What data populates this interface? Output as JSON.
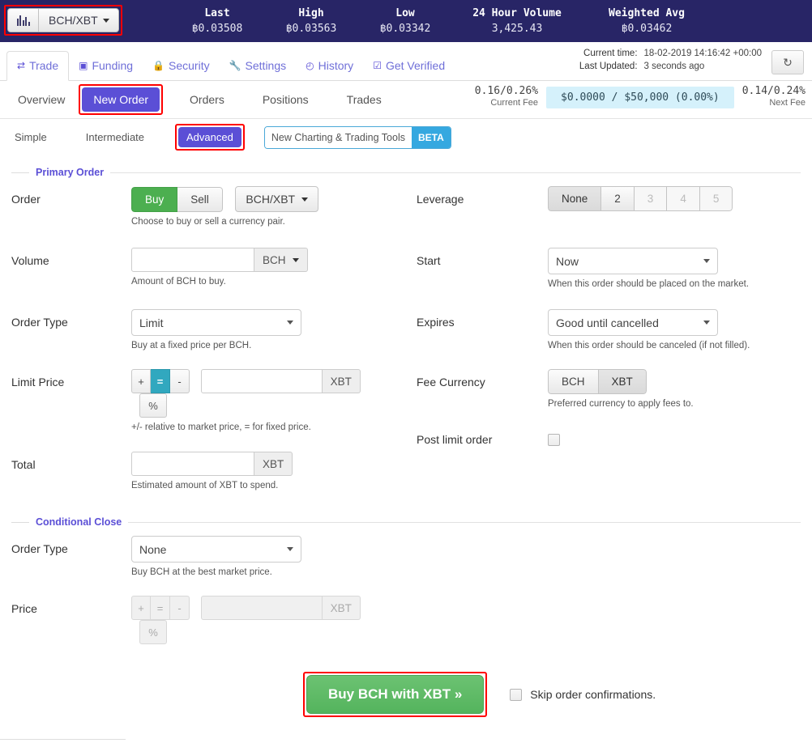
{
  "ticker": {
    "pair_button": {
      "label": "BCH/XBT",
      "icon": "chart-bars-icon",
      "caret": "▼"
    },
    "stats": [
      {
        "title": "Last",
        "value": "฿0.03508"
      },
      {
        "title": "High",
        "value": "฿0.03563"
      },
      {
        "title": "Low",
        "value": "฿0.03342"
      },
      {
        "title": "24 Hour Volume",
        "value": "3,425.43"
      },
      {
        "title": "Weighted Avg",
        "value": "฿0.03462"
      }
    ]
  },
  "mainnav": {
    "tabs": [
      {
        "label": "Trade",
        "icon": "exchange-icon",
        "glyph": "⇄",
        "active": true
      },
      {
        "label": "Funding",
        "icon": "banknote-icon",
        "glyph": "▣",
        "active": false
      },
      {
        "label": "Security",
        "icon": "lock-icon",
        "glyph": "🔒",
        "active": false
      },
      {
        "label": "Settings",
        "icon": "wrench-icon",
        "glyph": "🔧",
        "active": false
      },
      {
        "label": "History",
        "icon": "clock-icon",
        "glyph": "◴",
        "active": false
      },
      {
        "label": "Get Verified",
        "icon": "check-square-icon",
        "glyph": "☑",
        "active": false
      }
    ],
    "current_time_label": "Current time:",
    "current_time_value": "18-02-2019 14:16:42 +00:00",
    "last_updated_label": "Last Updated:",
    "last_updated_value": "3 seconds ago",
    "refresh_icon": "refresh-icon",
    "refresh_glyph": "↻"
  },
  "subnav": {
    "tabs": [
      {
        "label": "Overview",
        "active": false
      },
      {
        "label": "New Order",
        "active": true
      },
      {
        "label": "Orders",
        "active": false
      },
      {
        "label": "Positions",
        "active": false
      },
      {
        "label": "Trades",
        "active": false
      }
    ],
    "current_fee_value": "0.16/0.26%",
    "current_fee_label": "Current Fee",
    "volume_pill": "$0.0000 / $50,000 (0.00%)",
    "next_fee_value": "0.14/0.24%",
    "next_fee_label": "Next Fee"
  },
  "modes": {
    "items": [
      {
        "label": "Simple",
        "active": false
      },
      {
        "label": "Intermediate",
        "active": false
      },
      {
        "label": "Advanced",
        "active": true
      }
    ],
    "beta_text": "New Charting & Trading Tools",
    "beta_badge": "BETA"
  },
  "primary_order": {
    "legend": "Primary Order",
    "order": {
      "label": "Order",
      "buy": "Buy",
      "sell": "Sell",
      "pair": "BCH/XBT",
      "hint": "Choose to buy or sell a currency pair."
    },
    "volume": {
      "label": "Volume",
      "value": "",
      "unit": "BCH",
      "hint": "Amount of BCH to buy."
    },
    "order_type": {
      "label": "Order Type",
      "value": "Limit",
      "hint": "Buy at a fixed price per BCH."
    },
    "limit_price": {
      "label": "Limit Price",
      "plus": "+",
      "equals": "=",
      "minus": "-",
      "value": "",
      "unit": "XBT",
      "percent": "%",
      "hint": "+/- relative to market price, = for fixed price."
    },
    "total": {
      "label": "Total",
      "value": "",
      "unit": "XBT",
      "hint": "Estimated amount of XBT to spend."
    },
    "leverage": {
      "label": "Leverage",
      "options": [
        {
          "label": "None",
          "state": "active"
        },
        {
          "label": "2",
          "state": "enabled"
        },
        {
          "label": "3",
          "state": "disabled"
        },
        {
          "label": "4",
          "state": "disabled"
        },
        {
          "label": "5",
          "state": "disabled"
        }
      ]
    },
    "start": {
      "label": "Start",
      "value": "Now",
      "hint": "When this order should be placed on the market."
    },
    "expires": {
      "label": "Expires",
      "value": "Good until cancelled",
      "hint": "When this order should be canceled (if not filled)."
    },
    "fee_currency": {
      "label": "Fee Currency",
      "bch": "BCH",
      "xbt": "XBT",
      "hint": "Preferred currency to apply fees to."
    },
    "post_limit": {
      "label": "Post limit order",
      "checked": false
    }
  },
  "conditional_close": {
    "legend": "Conditional Close",
    "order_type": {
      "label": "Order Type",
      "value": "None",
      "hint": "Buy BCH at the best market price."
    },
    "price": {
      "label": "Price",
      "plus": "+",
      "equals": "=",
      "minus": "-",
      "value": "",
      "unit": "XBT",
      "percent": "%"
    }
  },
  "submit": {
    "button": "Buy BCH with XBT »",
    "skip_label": "Skip order confirmations.",
    "skip_checked": false
  },
  "colors": {
    "header_bg": "#282566",
    "accent_purple": "#5b4fd6",
    "buy_green": "#4caf50",
    "submit_green": "#54b45d",
    "highlight_red": "#ff0000",
    "fee_pill_bg": "#d5f1fb",
    "equals_active": "#31a8bf"
  }
}
